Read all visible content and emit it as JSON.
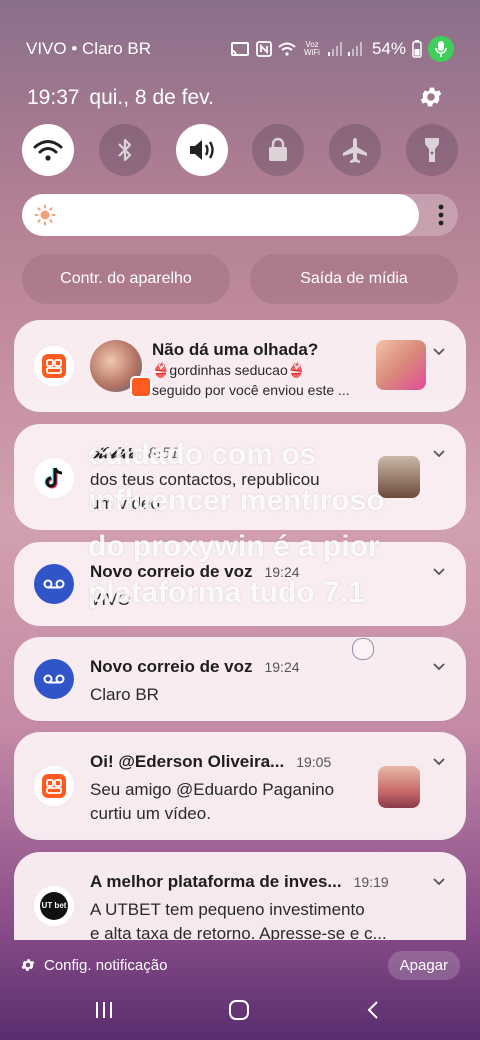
{
  "status_bar": {
    "carrier": "VIVO • Claro BR",
    "voz_wifi": "Voz WiFi",
    "battery": "54%",
    "icons": [
      "cast-icon",
      "nfc-icon",
      "wifi-calling-icon",
      "signal-icon",
      "signal-icon",
      "mic-active-icon"
    ]
  },
  "header": {
    "time": "19:37",
    "date": "qui., 8 de fev."
  },
  "quick_settings": [
    {
      "name": "wifi",
      "icon": "wifi-icon",
      "active": true
    },
    {
      "name": "bluetooth",
      "icon": "bluetooth-icon",
      "active": false
    },
    {
      "name": "sound",
      "icon": "volume-icon",
      "active": true
    },
    {
      "name": "lock",
      "icon": "lock-icon",
      "active": false
    },
    {
      "name": "airplane",
      "icon": "airplane-icon",
      "active": false
    },
    {
      "name": "flashlight",
      "icon": "flashlight-icon",
      "active": false
    }
  ],
  "brightness": {
    "level": 0.91
  },
  "media_buttons": {
    "device_control": "Contr. do aparelho",
    "media_output": "Saída de mídia"
  },
  "notifications": [
    {
      "title": "Não dá uma olhada?",
      "line1": "👙gordinhas seducao👙",
      "line2": "seguido por você enviou este ..."
    },
    {
      "title": "𝓚𝓮𝓵𝓲𝓽𝓪",
      "time": "8:51",
      "line1": "dos teus contactos, republicou",
      "line2": "um vídeo"
    },
    {
      "title": "Novo correio de voz",
      "time": "19:24",
      "line1": "VIVO"
    },
    {
      "title": "Novo correio de voz",
      "time": "19:24",
      "line1": "Claro BR"
    },
    {
      "title": "Oi! @Ederson Oliveira...",
      "time": "19:05",
      "line1": "Seu amigo @Eduardo Paganino",
      "line2": "curtiu um vídeo."
    },
    {
      "title": "A melhor plataforma de inves...",
      "time": "19:19",
      "line1": "A UTBET tem pequeno investimento",
      "line2": "e alta taxa de retorno. Apresse-se e c..."
    }
  ],
  "overlay_text": "cuidado com os influencer mentiroso do proxywin é a pior plataforma  tudo 7.1",
  "utbet_logo": "UT bet",
  "footer": {
    "settings": "Config. notificação",
    "clear": "Apagar"
  },
  "colors": {
    "accent_wifi": "#ffffff",
    "voicemail_blue": "#2f55c9",
    "kwai_orange": "#ff5a1f",
    "mic_green": "#3ecf5a"
  }
}
